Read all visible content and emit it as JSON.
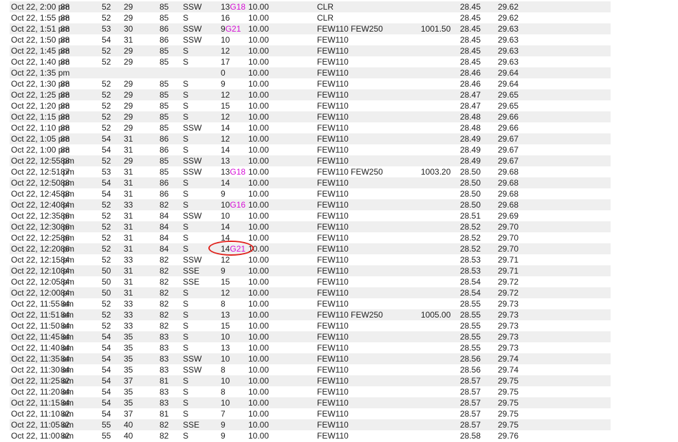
{
  "colors": {
    "gust": "#d60fd6",
    "row_stripe": "#efefef",
    "annotation": "#e0211b"
  },
  "rows": [
    {
      "time": "Oct 22, 2:00 pm",
      "temp": "88",
      "dew": "52",
      "hum": "29",
      "chill": "85",
      "dir": "SSW",
      "speed": "13",
      "gust": "G18",
      "vis": "10.00",
      "sky": "CLR",
      "pres": "",
      "altim": "28.45",
      "sealvl": "29.62"
    },
    {
      "time": "Oct 22, 1:55 pm",
      "temp": "88",
      "dew": "52",
      "hum": "29",
      "chill": "85",
      "dir": "S",
      "speed": "16",
      "gust": "",
      "vis": "10.00",
      "sky": "CLR",
      "pres": "",
      "altim": "28.45",
      "sealvl": "29.62"
    },
    {
      "time": "Oct 22, 1:51 pm",
      "temp": "88",
      "dew": "53",
      "hum": "30",
      "chill": "86",
      "dir": "SSW",
      "speed": "9",
      "gust": "G21",
      "vis": "10.00",
      "sky": "FEW110 FEW250",
      "pres": "1001.50",
      "altim": "28.45",
      "sealvl": "29.63"
    },
    {
      "time": "Oct 22, 1:50 pm",
      "temp": "88",
      "dew": "54",
      "hum": "31",
      "chill": "86",
      "dir": "SSW",
      "speed": "10",
      "gust": "",
      "vis": "10.00",
      "sky": "FEW110",
      "pres": "",
      "altim": "28.45",
      "sealvl": "29.63"
    },
    {
      "time": "Oct 22, 1:45 pm",
      "temp": "88",
      "dew": "52",
      "hum": "29",
      "chill": "85",
      "dir": "S",
      "speed": "12",
      "gust": "",
      "vis": "10.00",
      "sky": "FEW110",
      "pres": "",
      "altim": "28.45",
      "sealvl": "29.63"
    },
    {
      "time": "Oct 22, 1:40 pm",
      "temp": "88",
      "dew": "52",
      "hum": "29",
      "chill": "85",
      "dir": "S",
      "speed": "17",
      "gust": "",
      "vis": "10.00",
      "sky": "FEW110",
      "pres": "",
      "altim": "28.45",
      "sealvl": "29.63"
    },
    {
      "time": "Oct 22, 1:35 pm",
      "temp": "",
      "dew": "",
      "hum": "",
      "chill": "",
      "dir": "",
      "speed": "0",
      "gust": "",
      "vis": "10.00",
      "sky": "FEW110",
      "pres": "",
      "altim": "28.46",
      "sealvl": "29.64"
    },
    {
      "time": "Oct 22, 1:30 pm",
      "temp": "88",
      "dew": "52",
      "hum": "29",
      "chill": "85",
      "dir": "S",
      "speed": "9",
      "gust": "",
      "vis": "10.00",
      "sky": "FEW110",
      "pres": "",
      "altim": "28.46",
      "sealvl": "29.64"
    },
    {
      "time": "Oct 22, 1:25 pm",
      "temp": "88",
      "dew": "52",
      "hum": "29",
      "chill": "85",
      "dir": "S",
      "speed": "12",
      "gust": "",
      "vis": "10.00",
      "sky": "FEW110",
      "pres": "",
      "altim": "28.47",
      "sealvl": "29.65"
    },
    {
      "time": "Oct 22, 1:20 pm",
      "temp": "88",
      "dew": "52",
      "hum": "29",
      "chill": "85",
      "dir": "S",
      "speed": "15",
      "gust": "",
      "vis": "10.00",
      "sky": "FEW110",
      "pres": "",
      "altim": "28.47",
      "sealvl": "29.65"
    },
    {
      "time": "Oct 22, 1:15 pm",
      "temp": "88",
      "dew": "52",
      "hum": "29",
      "chill": "85",
      "dir": "S",
      "speed": "12",
      "gust": "",
      "vis": "10.00",
      "sky": "FEW110",
      "pres": "",
      "altim": "28.48",
      "sealvl": "29.66"
    },
    {
      "time": "Oct 22, 1:10 pm",
      "temp": "88",
      "dew": "52",
      "hum": "29",
      "chill": "85",
      "dir": "SSW",
      "speed": "14",
      "gust": "",
      "vis": "10.00",
      "sky": "FEW110",
      "pres": "",
      "altim": "28.48",
      "sealvl": "29.66"
    },
    {
      "time": "Oct 22, 1:05 pm",
      "temp": "88",
      "dew": "54",
      "hum": "31",
      "chill": "86",
      "dir": "S",
      "speed": "12",
      "gust": "",
      "vis": "10.00",
      "sky": "FEW110",
      "pres": "",
      "altim": "28.49",
      "sealvl": "29.67"
    },
    {
      "time": "Oct 22, 1:00 pm",
      "temp": "88",
      "dew": "54",
      "hum": "31",
      "chill": "86",
      "dir": "S",
      "speed": "14",
      "gust": "",
      "vis": "10.00",
      "sky": "FEW110",
      "pres": "",
      "altim": "28.49",
      "sealvl": "29.67"
    },
    {
      "time": "Oct 22, 12:55 pm",
      "temp": "88",
      "dew": "52",
      "hum": "29",
      "chill": "85",
      "dir": "SSW",
      "speed": "13",
      "gust": "",
      "vis": "10.00",
      "sky": "FEW110",
      "pres": "",
      "altim": "28.49",
      "sealvl": "29.67"
    },
    {
      "time": "Oct 22, 12:51 pm",
      "temp": "87",
      "dew": "53",
      "hum": "31",
      "chill": "85",
      "dir": "SSW",
      "speed": "13",
      "gust": "G18",
      "vis": "10.00",
      "sky": "FEW110 FEW250",
      "pres": "1003.20",
      "altim": "28.50",
      "sealvl": "29.68"
    },
    {
      "time": "Oct 22, 12:50 pm",
      "temp": "88",
      "dew": "54",
      "hum": "31",
      "chill": "86",
      "dir": "S",
      "speed": "14",
      "gust": "",
      "vis": "10.00",
      "sky": "FEW110",
      "pres": "",
      "altim": "28.50",
      "sealvl": "29.68"
    },
    {
      "time": "Oct 22, 12:45 pm",
      "temp": "88",
      "dew": "54",
      "hum": "31",
      "chill": "86",
      "dir": "S",
      "speed": "9",
      "gust": "",
      "vis": "10.00",
      "sky": "FEW110",
      "pres": "",
      "altim": "28.50",
      "sealvl": "29.68"
    },
    {
      "time": "Oct 22, 12:40 pm",
      "temp": "84",
      "dew": "52",
      "hum": "33",
      "chill": "82",
      "dir": "S",
      "speed": "10",
      "gust": "G16",
      "vis": "10.00",
      "sky": "FEW110",
      "pres": "",
      "altim": "28.50",
      "sealvl": "29.68"
    },
    {
      "time": "Oct 22, 12:35 pm",
      "temp": "86",
      "dew": "52",
      "hum": "31",
      "chill": "84",
      "dir": "SSW",
      "speed": "10",
      "gust": "",
      "vis": "10.00",
      "sky": "FEW110",
      "pres": "",
      "altim": "28.51",
      "sealvl": "29.69"
    },
    {
      "time": "Oct 22, 12:30 pm",
      "temp": "86",
      "dew": "52",
      "hum": "31",
      "chill": "84",
      "dir": "S",
      "speed": "14",
      "gust": "",
      "vis": "10.00",
      "sky": "FEW110",
      "pres": "",
      "altim": "28.52",
      "sealvl": "29.70"
    },
    {
      "time": "Oct 22, 12:25 pm",
      "temp": "86",
      "dew": "52",
      "hum": "31",
      "chill": "84",
      "dir": "S",
      "speed": "14",
      "gust": "",
      "vis": "10.00",
      "sky": "FEW110",
      "pres": "",
      "altim": "28.52",
      "sealvl": "29.70"
    },
    {
      "time": "Oct 22, 12:20 pm",
      "temp": "86",
      "dew": "52",
      "hum": "31",
      "chill": "84",
      "dir": "S",
      "speed": "14",
      "gust": "G21",
      "vis": "10.00",
      "sky": "FEW110",
      "pres": "",
      "altim": "28.52",
      "sealvl": "29.70"
    },
    {
      "time": "Oct 22, 12:15 pm",
      "temp": "84",
      "dew": "52",
      "hum": "33",
      "chill": "82",
      "dir": "SSW",
      "speed": "12",
      "gust": "",
      "vis": "10.00",
      "sky": "FEW110",
      "pres": "",
      "altim": "28.53",
      "sealvl": "29.71"
    },
    {
      "time": "Oct 22, 12:10 pm",
      "temp": "84",
      "dew": "50",
      "hum": "31",
      "chill": "82",
      "dir": "SSE",
      "speed": "9",
      "gust": "",
      "vis": "10.00",
      "sky": "FEW110",
      "pres": "",
      "altim": "28.53",
      "sealvl": "29.71"
    },
    {
      "time": "Oct 22, 12:05 pm",
      "temp": "84",
      "dew": "50",
      "hum": "31",
      "chill": "82",
      "dir": "SSE",
      "speed": "15",
      "gust": "",
      "vis": "10.00",
      "sky": "FEW110",
      "pres": "",
      "altim": "28.54",
      "sealvl": "29.72"
    },
    {
      "time": "Oct 22, 12:00 pm",
      "temp": "84",
      "dew": "50",
      "hum": "31",
      "chill": "82",
      "dir": "S",
      "speed": "12",
      "gust": "",
      "vis": "10.00",
      "sky": "FEW110",
      "pres": "",
      "altim": "28.54",
      "sealvl": "29.72"
    },
    {
      "time": "Oct 22, 11:55 am",
      "temp": "84",
      "dew": "52",
      "hum": "33",
      "chill": "82",
      "dir": "S",
      "speed": "8",
      "gust": "",
      "vis": "10.00",
      "sky": "FEW110",
      "pres": "",
      "altim": "28.55",
      "sealvl": "29.73"
    },
    {
      "time": "Oct 22, 11:51 am",
      "temp": "84",
      "dew": "52",
      "hum": "33",
      "chill": "82",
      "dir": "S",
      "speed": "13",
      "gust": "",
      "vis": "10.00",
      "sky": "FEW110 FEW250",
      "pres": "1005.00",
      "altim": "28.55",
      "sealvl": "29.73"
    },
    {
      "time": "Oct 22, 11:50 am",
      "temp": "84",
      "dew": "52",
      "hum": "33",
      "chill": "82",
      "dir": "S",
      "speed": "15",
      "gust": "",
      "vis": "10.00",
      "sky": "FEW110",
      "pres": "",
      "altim": "28.55",
      "sealvl": "29.73"
    },
    {
      "time": "Oct 22, 11:45 am",
      "temp": "84",
      "dew": "54",
      "hum": "35",
      "chill": "83",
      "dir": "S",
      "speed": "10",
      "gust": "",
      "vis": "10.00",
      "sky": "FEW110",
      "pres": "",
      "altim": "28.55",
      "sealvl": "29.73"
    },
    {
      "time": "Oct 22, 11:40 am",
      "temp": "84",
      "dew": "54",
      "hum": "35",
      "chill": "83",
      "dir": "S",
      "speed": "13",
      "gust": "",
      "vis": "10.00",
      "sky": "FEW110",
      "pres": "",
      "altim": "28.55",
      "sealvl": "29.73"
    },
    {
      "time": "Oct 22, 11:35 am",
      "temp": "84",
      "dew": "54",
      "hum": "35",
      "chill": "83",
      "dir": "SSW",
      "speed": "10",
      "gust": "",
      "vis": "10.00",
      "sky": "FEW110",
      "pres": "",
      "altim": "28.56",
      "sealvl": "29.74"
    },
    {
      "time": "Oct 22, 11:30 am",
      "temp": "84",
      "dew": "54",
      "hum": "35",
      "chill": "83",
      "dir": "SSW",
      "speed": "8",
      "gust": "",
      "vis": "10.00",
      "sky": "FEW110",
      "pres": "",
      "altim": "28.56",
      "sealvl": "29.74"
    },
    {
      "time": "Oct 22, 11:25 am",
      "temp": "82",
      "dew": "54",
      "hum": "37",
      "chill": "81",
      "dir": "S",
      "speed": "10",
      "gust": "",
      "vis": "10.00",
      "sky": "FEW110",
      "pres": "",
      "altim": "28.57",
      "sealvl": "29.75"
    },
    {
      "time": "Oct 22, 11:20 am",
      "temp": "84",
      "dew": "54",
      "hum": "35",
      "chill": "83",
      "dir": "S",
      "speed": "8",
      "gust": "",
      "vis": "10.00",
      "sky": "FEW110",
      "pres": "",
      "altim": "28.57",
      "sealvl": "29.75"
    },
    {
      "time": "Oct 22, 11:15 am",
      "temp": "84",
      "dew": "54",
      "hum": "35",
      "chill": "83",
      "dir": "S",
      "speed": "10",
      "gust": "",
      "vis": "10.00",
      "sky": "FEW110",
      "pres": "",
      "altim": "28.57",
      "sealvl": "29.75"
    },
    {
      "time": "Oct 22, 11:10 am",
      "temp": "82",
      "dew": "54",
      "hum": "37",
      "chill": "81",
      "dir": "S",
      "speed": "7",
      "gust": "",
      "vis": "10.00",
      "sky": "FEW110",
      "pres": "",
      "altim": "28.57",
      "sealvl": "29.75"
    },
    {
      "time": "Oct 22, 11:05 am",
      "temp": "82",
      "dew": "55",
      "hum": "40",
      "chill": "82",
      "dir": "SSE",
      "speed": "9",
      "gust": "",
      "vis": "10.00",
      "sky": "FEW110",
      "pres": "",
      "altim": "28.57",
      "sealvl": "29.75"
    },
    {
      "time": "Oct 22, 11:00 am",
      "temp": "82",
      "dew": "55",
      "hum": "40",
      "chill": "82",
      "dir": "S",
      "speed": "9",
      "gust": "",
      "vis": "10.00",
      "sky": "FEW110",
      "pres": "",
      "altim": "28.58",
      "sealvl": "29.76"
    }
  ]
}
